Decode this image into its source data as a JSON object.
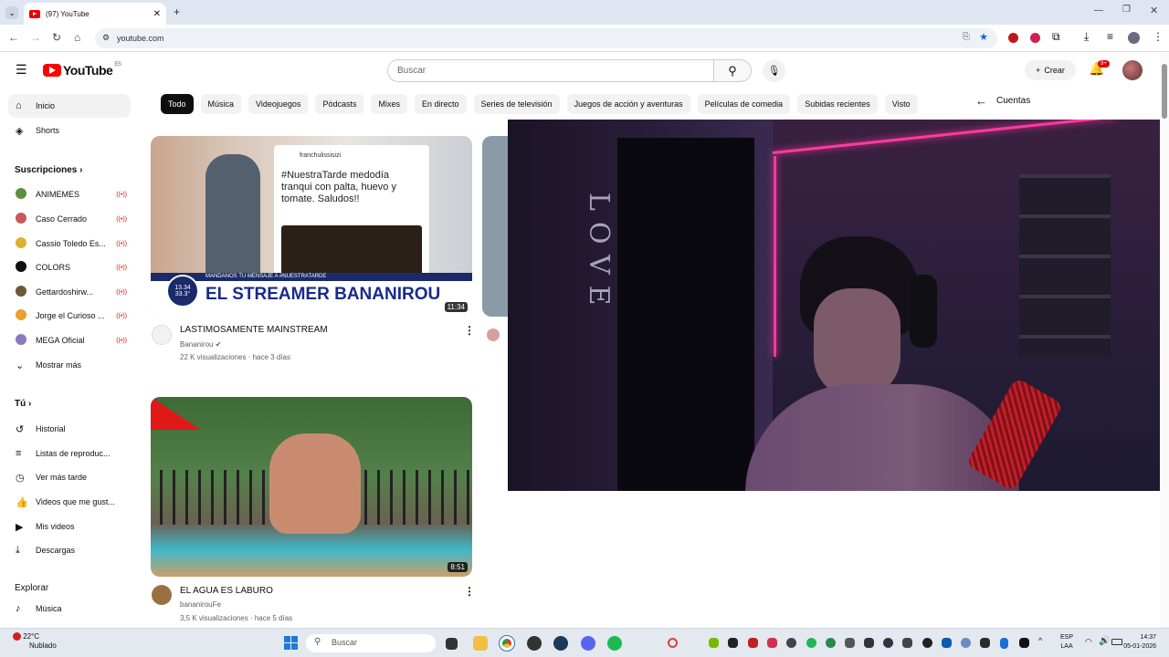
{
  "browser": {
    "tab_title": "(97) YouTube",
    "url": "youtube.com"
  },
  "header": {
    "logo_text": "YouTube",
    "logo_country": "ES",
    "search_placeholder": "Buscar",
    "create_label": "Crear",
    "notif_badge": "9+"
  },
  "sidebar": {
    "main": [
      {
        "label": "Inicio",
        "icon": "home-icon"
      },
      {
        "label": "Shorts",
        "icon": "shorts-icon"
      }
    ],
    "subs_title": "Suscripciones",
    "subs": [
      {
        "label": "ANIMEMES",
        "color": "#5a8f3c"
      },
      {
        "label": "Caso Cerrado",
        "color": "#c65a5a"
      },
      {
        "label": "Cassio Toledo Es...",
        "color": "#e0b030"
      },
      {
        "label": "COLORS",
        "color": "#111111"
      },
      {
        "label": "Gettardoshirw...",
        "color": "#6a5a3a"
      },
      {
        "label": "Jorge el Curioso ...",
        "color": "#e8a030"
      },
      {
        "label": "MEGA Oficial",
        "color": "#8a7ac0"
      }
    ],
    "show_more": "Mostrar más",
    "you_title": "Tú",
    "you": [
      {
        "label": "Historial",
        "icon": "history-icon"
      },
      {
        "label": "Listas de reproduc...",
        "icon": "playlist-icon"
      },
      {
        "label": "Ver más tarde",
        "icon": "clock-icon"
      },
      {
        "label": "Videos que me gust...",
        "icon": "like-icon"
      },
      {
        "label": "Mis videos",
        "icon": "video-icon"
      },
      {
        "label": "Descargas",
        "icon": "download-icon"
      }
    ],
    "explore_title": "Explorar",
    "explore": [
      {
        "label": "Música",
        "icon": "music-icon"
      }
    ]
  },
  "chips": [
    "Todo",
    "Música",
    "Videojuegos",
    "Pódcasts",
    "Mixes",
    "En directo",
    "Series de televisión",
    "Juegos de acción y aventuras",
    "Películas de comedia",
    "Subidas recientes",
    "Visto"
  ],
  "videos": [
    {
      "title": "LASTIMOSAMENTE MAINSTREAM",
      "channel": "Bananirou",
      "meta": "22 K visualizaciones · hace 3 días",
      "duration": "11:34",
      "thumb_caption": "EL STREAMER BANANIROU",
      "thumb_banner": "MANDANOS TU MENSAJE A #NUESTRATARDE",
      "thumb_user": "franchulissisizi",
      "thumb_tweet": "#NuestraTarde medodía tranqui con palta, huevo y tomate. Saludos!!",
      "thumb_time": "13.34",
      "thumb_temp": "33.3°"
    },
    {
      "title": "EL AGUA ES LABURO",
      "channel": "bananirouFe",
      "meta": "3,5 K visualizaciones · hace 5 días",
      "duration": "8:51"
    }
  ],
  "panel": {
    "accounts_label": "Cuentas"
  },
  "stream_text": "LOVE",
  "taskbar": {
    "weather_temp": "22°C",
    "weather_desc": "Nublado",
    "search": "Buscar",
    "lang_1": "ESP",
    "lang_2": "LAA",
    "time": "14:37",
    "date": "05-01-2026"
  }
}
